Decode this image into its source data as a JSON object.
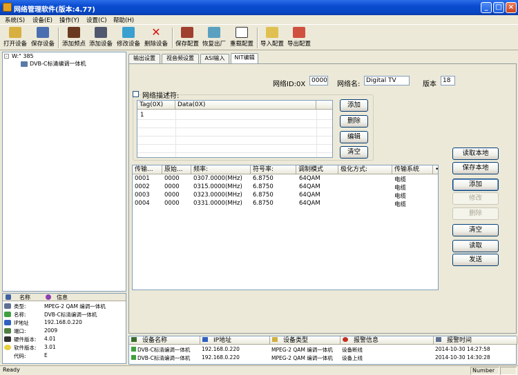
{
  "window": {
    "title": "网络管理软件(版本:4.77)",
    "min": "_",
    "max": "□",
    "close": "×"
  },
  "menu": [
    "系统(S)",
    "设备(E)",
    "操作(Y)",
    "设置(C)",
    "帮助(H)"
  ],
  "toolbar": [
    "打开设备",
    "保存设备",
    "添加频点",
    "添加设备",
    "修改设备",
    "删除设备",
    "保存配置",
    "恢复出厂",
    "重载配置",
    "导入配置",
    "导出配置"
  ],
  "tree": {
    "root": "W:\" 385",
    "child": "DVB-C标清编调一体机"
  },
  "info": {
    "col1": "名称",
    "col2": "信息",
    "rows": [
      {
        "label": "类型:",
        "value": "MPEG-2 QAM 编调一体机"
      },
      {
        "label": "名称:",
        "value": "DVB-C标清编调一体机"
      },
      {
        "label": "IP地址",
        "value": "192.168.0.220"
      },
      {
        "label": "端口:",
        "value": "2009"
      },
      {
        "label": "硬件版本:",
        "value": "4.01"
      },
      {
        "label": "软件版本:",
        "value": "3.01"
      },
      {
        "label": "代码:",
        "value": "E"
      }
    ]
  },
  "tabs": [
    "输出设置",
    "视音频设置",
    "ASI输入",
    "NIT编辑"
  ],
  "nit": {
    "network_id_label": "网络ID:0X",
    "network_id": "0000",
    "network_name_label": "网络名:",
    "network_name": "Digital TV",
    "version_label": "版本",
    "version": "18",
    "descriptor_label": "网络描述符:",
    "desc_cols": [
      "Tag(0X)",
      "Data(0X)"
    ],
    "desc_rows": [
      [
        "1",
        ""
      ]
    ],
    "desc_buttons": [
      "添加",
      "删除",
      "编辑",
      "清空"
    ]
  },
  "streams": {
    "cols": [
      "传输...",
      "原始...",
      "频率:",
      "符号率:",
      "调制模式",
      "极化方式:",
      "传输系统",
      "•"
    ],
    "rows": [
      [
        "0001",
        "0000",
        "0307.0000(MHz)",
        "6.8750",
        "64QAM",
        "",
        "电缆"
      ],
      [
        "0002",
        "0000",
        "0315.0000(MHz)",
        "6.8750",
        "64QAM",
        "",
        "电缆"
      ],
      [
        "0003",
        "0000",
        "0323.0000(MHz)",
        "6.8750",
        "64QAM",
        "",
        "电缆"
      ],
      [
        "0004",
        "0000",
        "0331.0000(MHz)",
        "6.8750",
        "64QAM",
        "",
        "电缆"
      ]
    ]
  },
  "side_buttons": [
    "读取本地",
    "保存本地",
    "添加",
    "修改",
    "删除",
    "清空",
    "读取",
    "发送"
  ],
  "log": {
    "cols": [
      "设备名称",
      "IP地址",
      "设备类型",
      "报警信息",
      "报警时间"
    ],
    "rows": [
      [
        "DVB-C标清编调一体机",
        "192.168.0.220",
        "MPEG-2 QAM 编调一体机",
        "设备断线",
        "2014-10-30 14:27:58"
      ],
      [
        "DVB-C标清编调一体机",
        "192.168.0.220",
        "MPEG-2 QAM 编调一体机",
        "设备上线",
        "2014-10-30 14:30:28"
      ]
    ]
  },
  "status": {
    "left": "Ready",
    "right": "Number"
  }
}
